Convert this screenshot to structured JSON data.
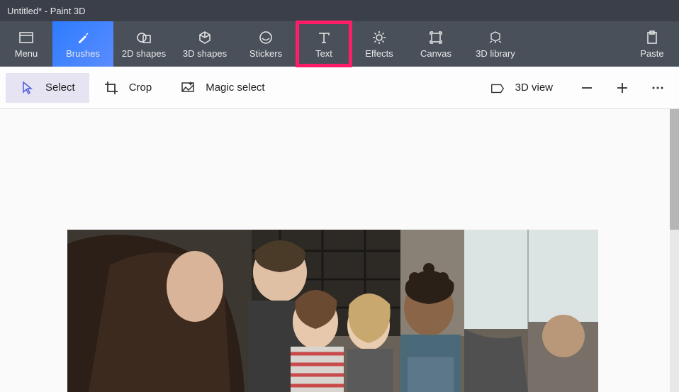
{
  "titlebar": {
    "title": "Untitled* - Paint 3D"
  },
  "ribbon": {
    "menu": "Menu",
    "items": [
      {
        "id": "brushes",
        "label": "Brushes",
        "active": true
      },
      {
        "id": "2d-shapes",
        "label": "2D shapes",
        "active": false
      },
      {
        "id": "3d-shapes",
        "label": "3D shapes",
        "active": false
      },
      {
        "id": "stickers",
        "label": "Stickers",
        "active": false
      },
      {
        "id": "text",
        "label": "Text",
        "active": false,
        "highlighted": true
      },
      {
        "id": "effects",
        "label": "Effects",
        "active": false
      },
      {
        "id": "canvas",
        "label": "Canvas",
        "active": false
      },
      {
        "id": "3d-library",
        "label": "3D library",
        "active": false
      }
    ],
    "paste": "Paste"
  },
  "toolbar": {
    "select": "Select",
    "crop": "Crop",
    "magic_select": "Magic select",
    "view_3d": "3D view"
  }
}
